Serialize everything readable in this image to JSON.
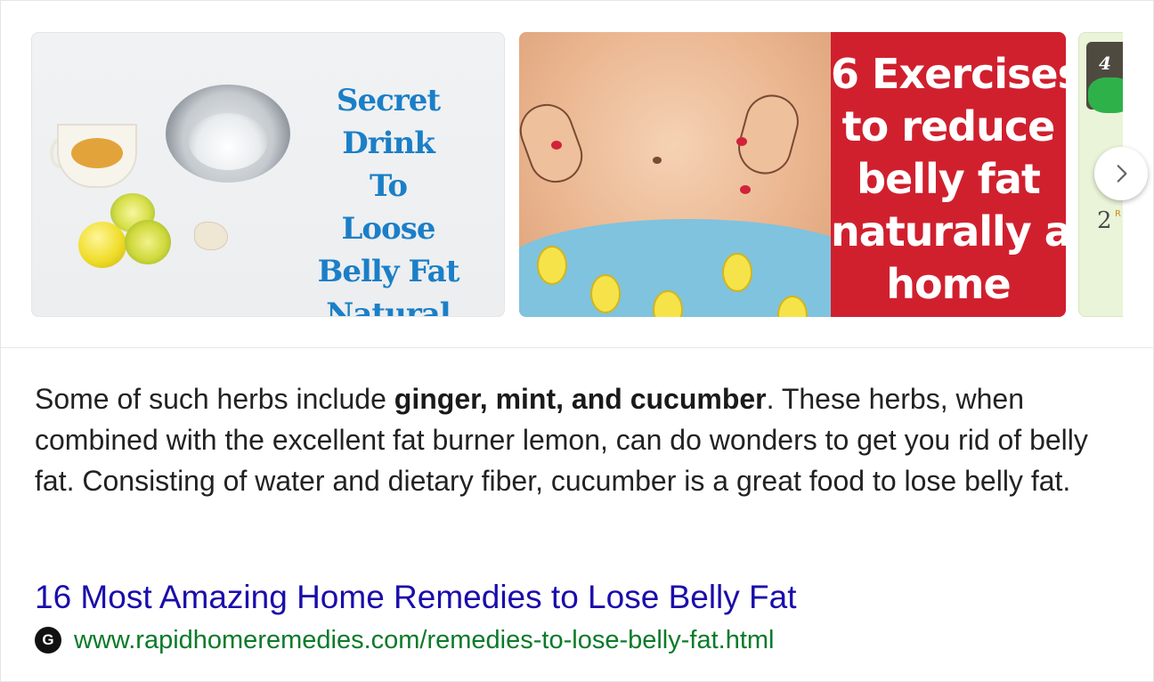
{
  "carousel": {
    "image1": {
      "lines": [
        "Secret Drink",
        "To",
        "Loose",
        "Belly Fat",
        "Natural Way"
      ]
    },
    "image2": {
      "lines": [
        "6 Exercises",
        "to reduce",
        "belly fat",
        "naturally at",
        "home"
      ]
    },
    "image3": {
      "top_number": "4",
      "bottom_number": "2",
      "bottom_small": "R S"
    },
    "next_icon": "chevron-right-icon"
  },
  "snippet": {
    "before": "Some of such herbs include ",
    "bold": "ginger, mint, and cucumber",
    "after": ". These herbs, when combined with the excellent fat burner lemon, can do wonders to get you rid of belly fat. Consisting of water and dietary fiber, cucumber is a great food to lose belly fat."
  },
  "result": {
    "title": "16 Most Amazing Home Remedies to Lose Belly Fat",
    "favicon_letter": "G",
    "url": "www.rapidhomeremedies.com/remedies-to-lose-belly-fat.html"
  },
  "colors": {
    "link": "#1a0dab",
    "url_green": "#0b7a29",
    "image1_text": "#1b7fc7",
    "image2_bg": "#d0202e"
  }
}
